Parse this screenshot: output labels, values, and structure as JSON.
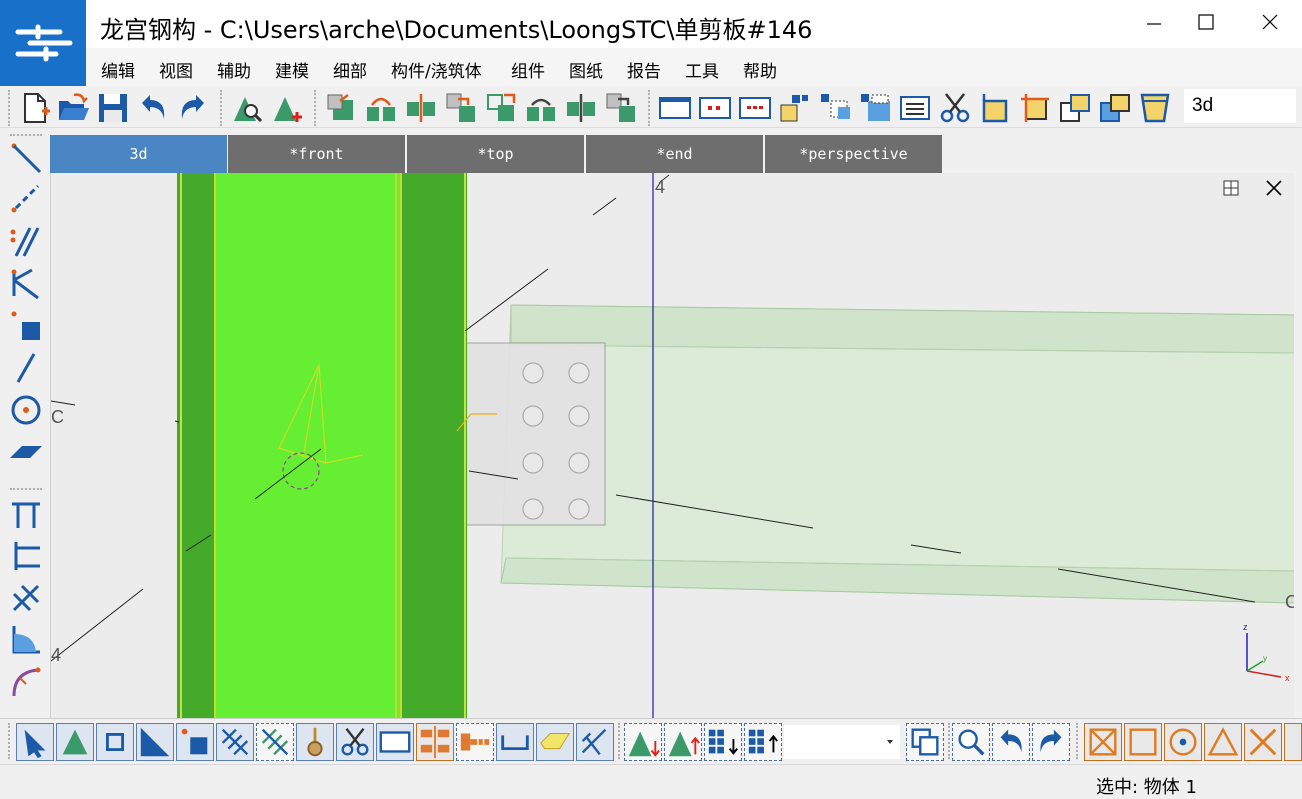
{
  "window": {
    "title": "龙宫钢构 - C:\\Users\\arche\\Documents\\LoongSTC\\单剪板#146"
  },
  "menu": [
    {
      "key": "edit",
      "label": "编辑"
    },
    {
      "key": "view",
      "label": "视图"
    },
    {
      "key": "assist",
      "label": "辅助"
    },
    {
      "key": "modeling",
      "label": "建模"
    },
    {
      "key": "detailing",
      "label": "细部"
    },
    {
      "key": "members",
      "label": "构件/浇筑体"
    },
    {
      "key": "components",
      "label": "组件"
    },
    {
      "key": "drawings",
      "label": "图纸"
    },
    {
      "key": "reports",
      "label": "报告"
    },
    {
      "key": "tools",
      "label": "工具"
    },
    {
      "key": "help",
      "label": "帮助"
    }
  ],
  "toolbar": {
    "view_name": "3d"
  },
  "tabs": [
    {
      "key": "3d",
      "label": "3d",
      "active": true
    },
    {
      "key": "front",
      "label": "*front",
      "active": false
    },
    {
      "key": "top",
      "label": "*top",
      "active": false
    },
    {
      "key": "end",
      "label": "*end",
      "active": false
    },
    {
      "key": "perspective",
      "label": "*perspective",
      "active": false
    }
  ],
  "viewport": {
    "grid_labels": {
      "top_4": "4",
      "left_c": "C",
      "bottom_left_4": "4",
      "right_c": "C"
    },
    "axis": {
      "x": "x",
      "y": "y",
      "z": "z"
    },
    "colors": {
      "column_light": "#66ee33",
      "column_dark": "#44aa2a",
      "beam": "#d8ecd4",
      "plate": "#dedede",
      "grid_line": "#1a1aaa"
    }
  },
  "status": {
    "selection": "选中: 物体 1"
  },
  "colors": {
    "accent": "#1870c8",
    "tab_active": "#4a86c4",
    "tab_inactive": "#6e6e6e"
  }
}
